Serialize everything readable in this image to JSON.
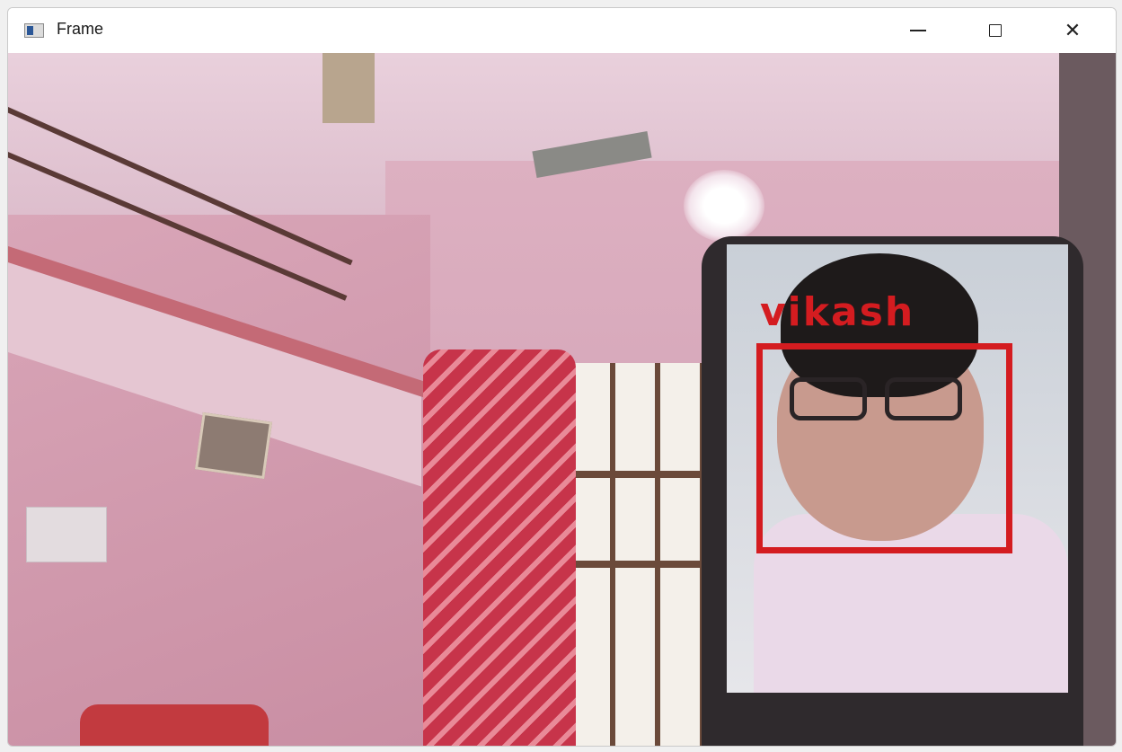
{
  "window": {
    "title": "Frame",
    "controls": {
      "minimize_icon": "minimize-icon",
      "maximize_icon": "maximize-icon",
      "close_glyph": "✕"
    }
  },
  "video": {
    "detection": {
      "label": "vikash",
      "box_color": "#d41c20"
    }
  }
}
